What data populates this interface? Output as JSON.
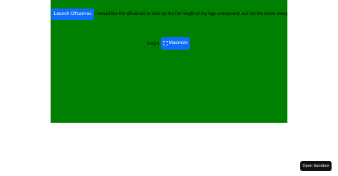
{
  "app": {
    "background_color": "#008000",
    "launch_label": "Launch Offcanvas",
    "description": "I would like the offcanvas to take up the full height of my App component, but not the entire viewport",
    "height_label": "height",
    "maximize": {
      "icon": "maximize-icon",
      "label": "Maximize"
    }
  },
  "sandbox": {
    "open_label": "Open Sandbox"
  },
  "colors": {
    "primary_button": "#0d6efd",
    "sandbox_button": "#111111"
  }
}
